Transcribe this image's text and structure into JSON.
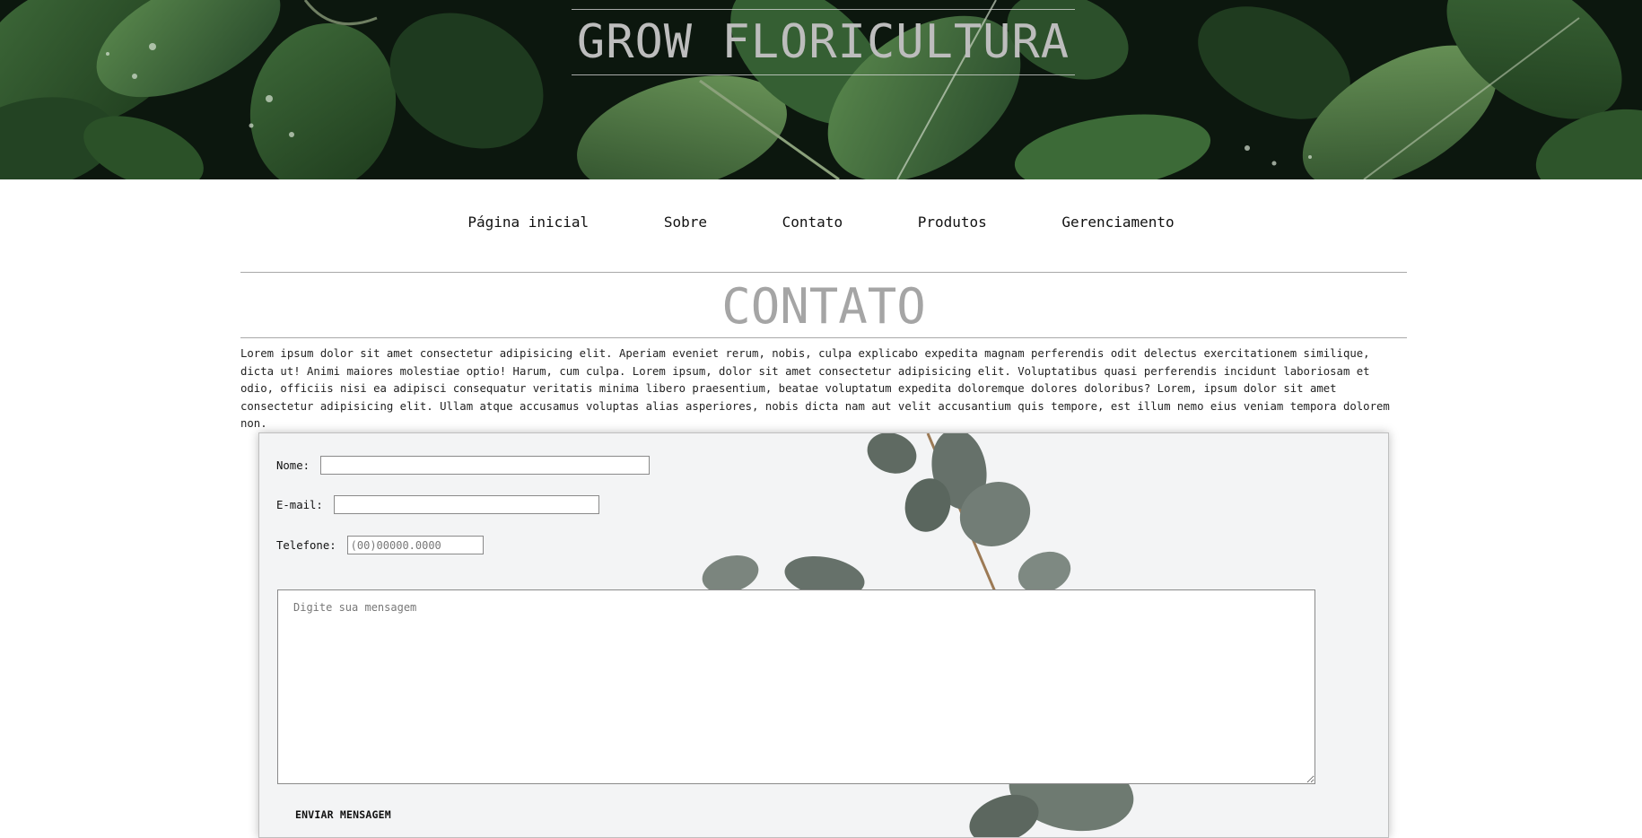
{
  "header": {
    "brand": "GROW FLORICULTURA"
  },
  "nav": {
    "items": [
      {
        "label": "Página inicial"
      },
      {
        "label": "Sobre"
      },
      {
        "label": "Contato"
      },
      {
        "label": "Produtos"
      },
      {
        "label": "Gerenciamento"
      }
    ]
  },
  "main": {
    "title": "CONTATO",
    "intro": "Lorem ipsum dolor sit amet consectetur adipisicing elit. Aperiam eveniet rerum, nobis, culpa explicabo expedita magnam perferendis odit delectus exercitationem similique, dicta ut! Animi maiores molestiae optio! Harum, cum culpa. Lorem ipsum, dolor sit amet consectetur adipisicing elit. Voluptatibus quasi perferendis incidunt laboriosam et odio, officiis nisi ea adipisci consequatur veritatis minima libero praesentium, beatae voluptatum expedita doloremque dolores doloribus? Lorem, ipsum dolor sit amet consectetur adipisicing elit. Ullam atque accusamus voluptas alias asperiores, nobis dicta nam aut velit accusantium quis tempore, est illum nemo eius veniam tempora dolorem non."
  },
  "form": {
    "name_label": "Nome:",
    "name_value": "",
    "email_label": "E-mail:",
    "email_value": "",
    "phone_label": "Telefone:",
    "phone_placeholder": "(00)00000.0000",
    "message_placeholder": "Digite sua mensagem",
    "submit_label": "ENVIAR MENSAGEM"
  },
  "colors": {
    "hero_dark": "#0d1a10",
    "leaf_green": "#2f5a2c",
    "title_gray": "#a5a5a5",
    "form_bg": "#f3f4f5"
  }
}
